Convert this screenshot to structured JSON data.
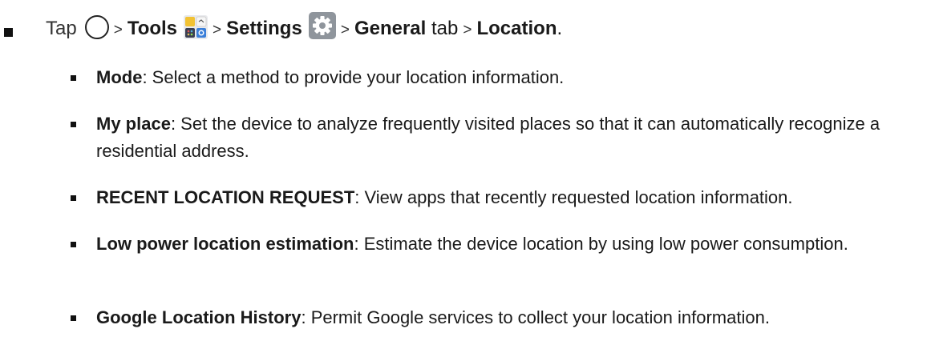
{
  "instruction": {
    "tap": "Tap",
    "sep": ">",
    "tools": "Tools",
    "settings": "Settings",
    "general": "General",
    "tab": "tab",
    "location": "Location",
    "period": "."
  },
  "icons": {
    "home": "home-circle-icon",
    "tools": "tools-folder-icon",
    "settings": "settings-gear-icon"
  },
  "items": [
    {
      "term": "Mode",
      "desc": ": Select a method to provide your location information."
    },
    {
      "term": "My place",
      "desc": ": Set the device to analyze frequently visited places so that it can automatically recognize a residential address."
    },
    {
      "term": "RECENT LOCATION REQUEST",
      "desc": ": View apps that recently requested location information."
    },
    {
      "term": "Low power location estimation",
      "desc": ": Estimate the device location by using low power consumption."
    },
    {
      "term": "Google Location History",
      "desc": ": Permit Google services to collect your location information."
    }
  ],
  "colors": {
    "settings_icon_bg": "#8f959c",
    "tools_tile_yellow": "#f2c233",
    "tools_tile_blue": "#3b7fd9",
    "tools_tile_dark": "#3a3f52"
  }
}
